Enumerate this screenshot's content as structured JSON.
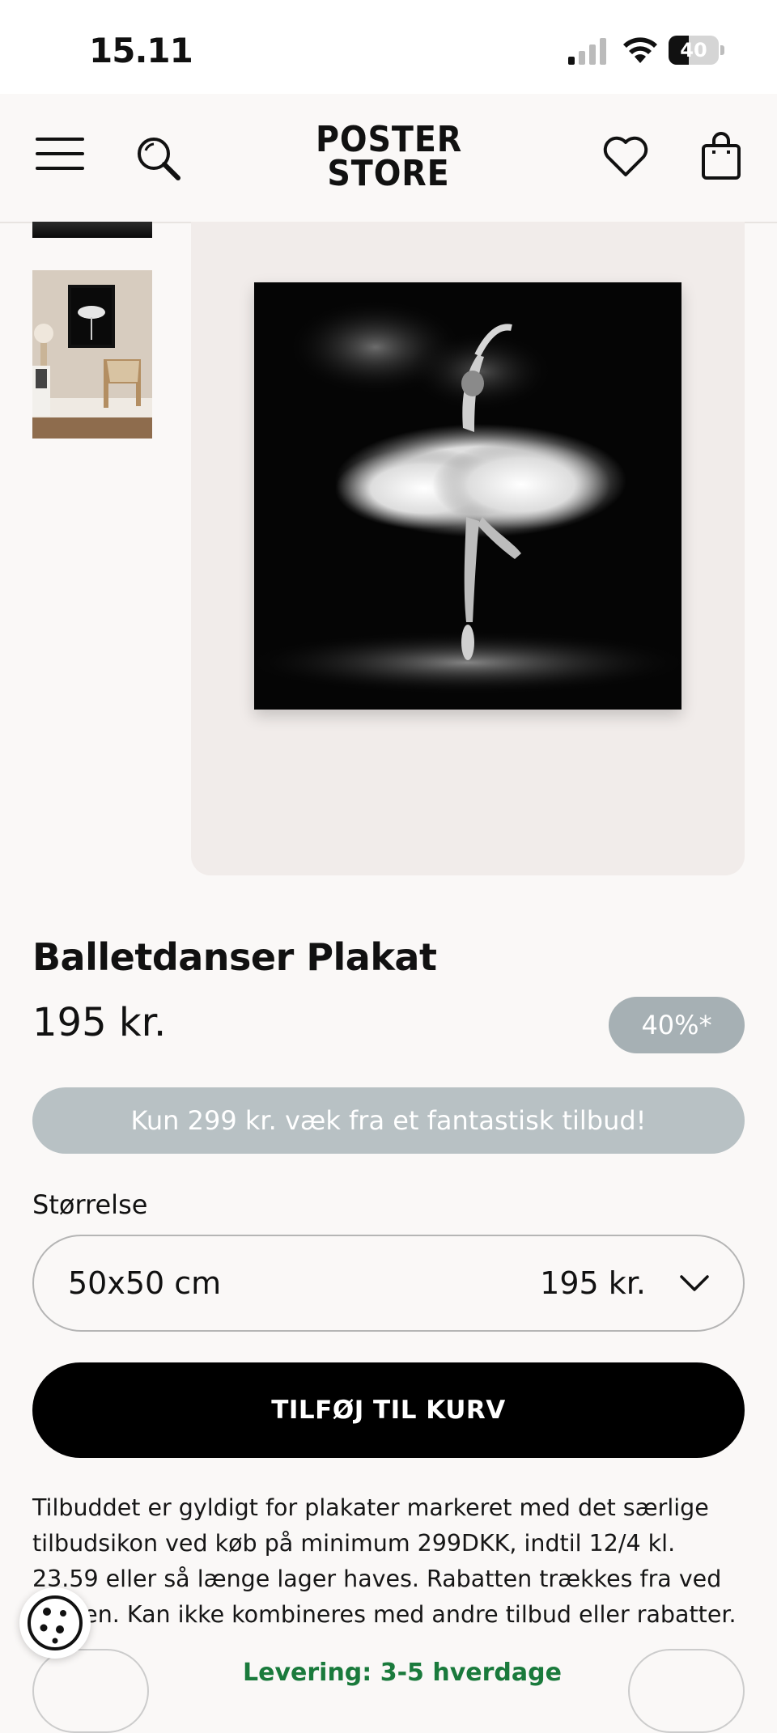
{
  "status_bar": {
    "time": "15.11",
    "battery": "40",
    "battery_level": 0.4
  },
  "header": {
    "logo_line1": "POSTER",
    "logo_line2": "STORE",
    "icons": [
      "menu-icon",
      "search-icon",
      "heart-icon",
      "bag-icon"
    ]
  },
  "product": {
    "title": "Balletdanser Plakat",
    "price": "195 kr.",
    "discount_badge": "40%*",
    "offer_banner": "Kun 299 kr. væk fra et fantastisk tilbud!",
    "size_label": "Størrelse",
    "selected_size": "50x50 cm",
    "selected_size_price": "195 kr.",
    "add_to_cart": "TILFØJ TIL KURV",
    "terms": "Tilbuddet er gyldigt for plakater markeret med det særlige tilbudsikon ved køb på minimum 299DKK, indtil 12/4 kl. 23.59 eller så længe lager haves. Rabatten trækkes fra ved kassen. Kan ikke kombineres med andre tilbud eller rabatter."
  },
  "delivery": {
    "text": "Levering: 3-5 hverdage"
  },
  "colors": {
    "accent_green": "#1a7a3c",
    "badge_grey": "#a6b0b4",
    "offer_grey": "#b8c1c4"
  }
}
